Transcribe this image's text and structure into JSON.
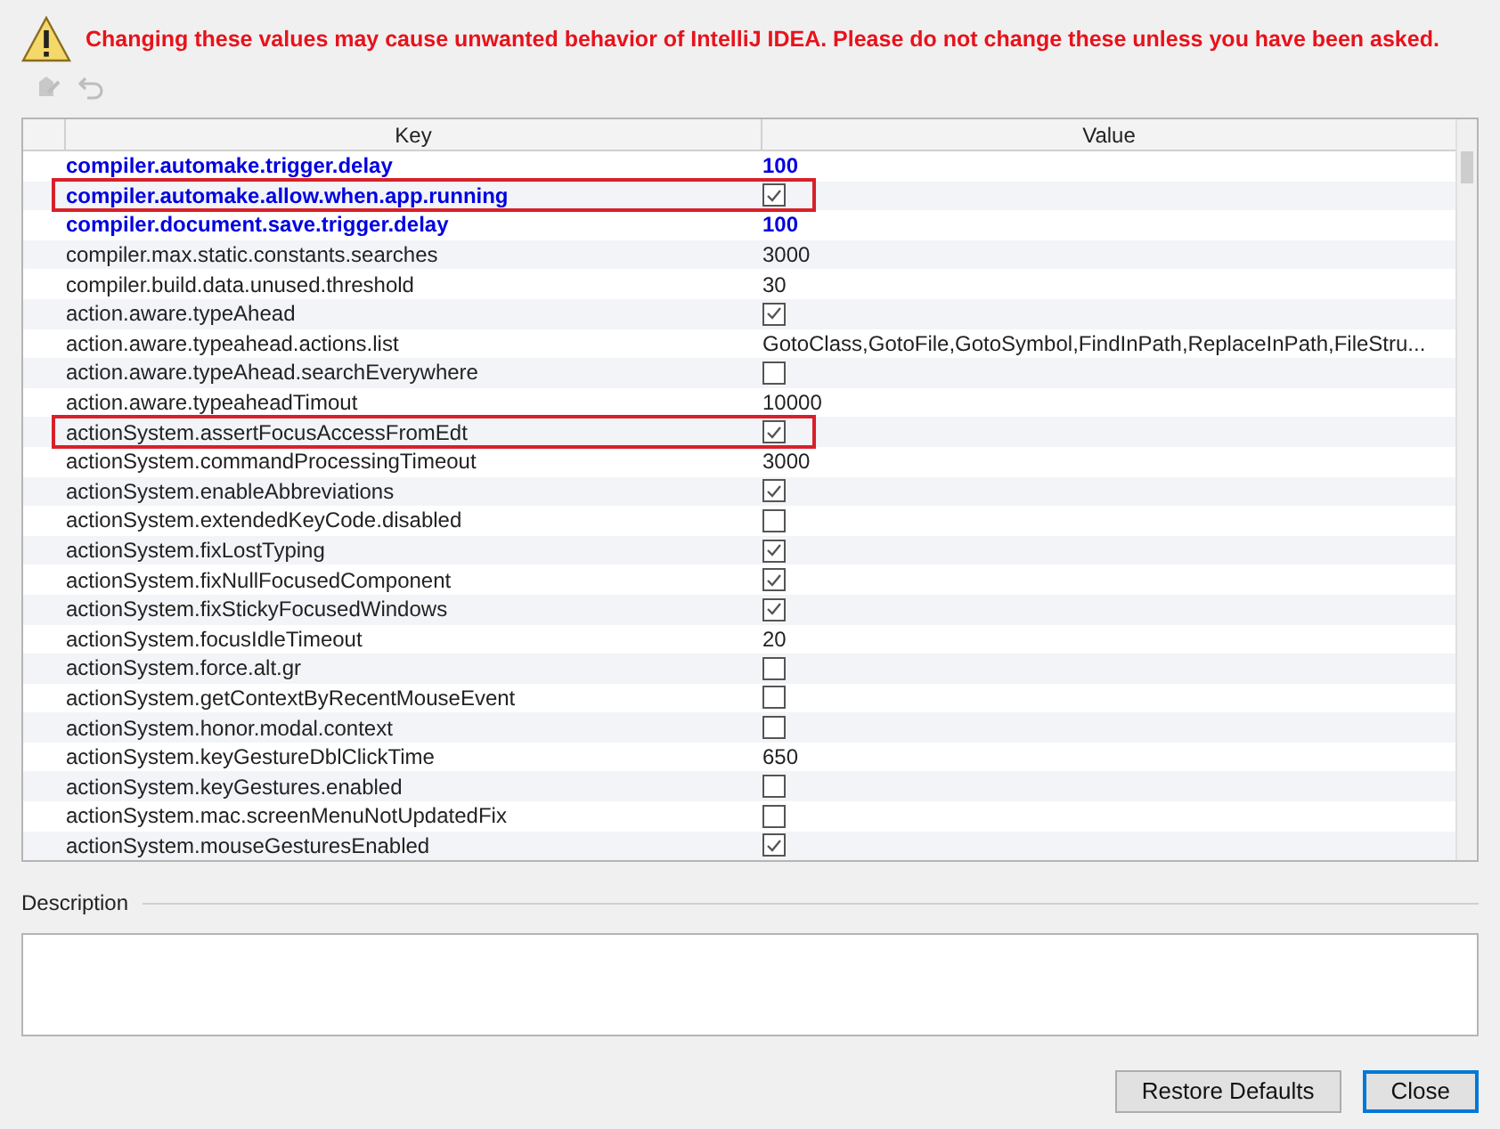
{
  "warning": {
    "text": "Changing these values may cause unwanted behavior of IntelliJ IDEA. Please do not change these unless you have been asked."
  },
  "table": {
    "columns": [
      "Key",
      "Value"
    ],
    "rows": [
      {
        "key": "compiler.automake.trigger.delay",
        "kind": "text",
        "value": "100",
        "modified": true,
        "highlighted": false
      },
      {
        "key": "compiler.automake.allow.when.app.running",
        "kind": "checkbox",
        "checked": true,
        "modified": true,
        "highlighted": true
      },
      {
        "key": "compiler.document.save.trigger.delay",
        "kind": "text",
        "value": "100",
        "modified": true,
        "highlighted": false
      },
      {
        "key": "compiler.max.static.constants.searches",
        "kind": "text",
        "value": "3000",
        "modified": false,
        "highlighted": false
      },
      {
        "key": "compiler.build.data.unused.threshold",
        "kind": "text",
        "value": "30",
        "modified": false,
        "highlighted": false
      },
      {
        "key": "action.aware.typeAhead",
        "kind": "checkbox",
        "checked": true,
        "modified": false,
        "highlighted": false
      },
      {
        "key": "action.aware.typeahead.actions.list",
        "kind": "text",
        "value": "GotoClass,GotoFile,GotoSymbol,FindInPath,ReplaceInPath,FileStru...",
        "modified": false,
        "highlighted": false
      },
      {
        "key": "action.aware.typeAhead.searchEverywhere",
        "kind": "checkbox",
        "checked": false,
        "modified": false,
        "highlighted": false
      },
      {
        "key": "action.aware.typeaheadTimout",
        "kind": "text",
        "value": "10000",
        "modified": false,
        "highlighted": false
      },
      {
        "key": "actionSystem.assertFocusAccessFromEdt",
        "kind": "checkbox",
        "checked": true,
        "modified": false,
        "highlighted": true
      },
      {
        "key": "actionSystem.commandProcessingTimeout",
        "kind": "text",
        "value": "3000",
        "modified": false,
        "highlighted": false
      },
      {
        "key": "actionSystem.enableAbbreviations",
        "kind": "checkbox",
        "checked": true,
        "modified": false,
        "highlighted": false
      },
      {
        "key": "actionSystem.extendedKeyCode.disabled",
        "kind": "checkbox",
        "checked": false,
        "modified": false,
        "highlighted": false
      },
      {
        "key": "actionSystem.fixLostTyping",
        "kind": "checkbox",
        "checked": true,
        "modified": false,
        "highlighted": false
      },
      {
        "key": "actionSystem.fixNullFocusedComponent",
        "kind": "checkbox",
        "checked": true,
        "modified": false,
        "highlighted": false
      },
      {
        "key": "actionSystem.fixStickyFocusedWindows",
        "kind": "checkbox",
        "checked": true,
        "modified": false,
        "highlighted": false
      },
      {
        "key": "actionSystem.focusIdleTimeout",
        "kind": "text",
        "value": "20",
        "modified": false,
        "highlighted": false
      },
      {
        "key": "actionSystem.force.alt.gr",
        "kind": "checkbox",
        "checked": false,
        "modified": false,
        "highlighted": false
      },
      {
        "key": "actionSystem.getContextByRecentMouseEvent",
        "kind": "checkbox",
        "checked": false,
        "modified": false,
        "highlighted": false
      },
      {
        "key": "actionSystem.honor.modal.context",
        "kind": "checkbox",
        "checked": false,
        "modified": false,
        "highlighted": false
      },
      {
        "key": "actionSystem.keyGestureDblClickTime",
        "kind": "text",
        "value": "650",
        "modified": false,
        "highlighted": false
      },
      {
        "key": "actionSystem.keyGestures.enabled",
        "kind": "checkbox",
        "checked": false,
        "modified": false,
        "highlighted": false
      },
      {
        "key": "actionSystem.mac.screenMenuNotUpdatedFix",
        "kind": "checkbox",
        "checked": false,
        "modified": false,
        "highlighted": false
      },
      {
        "key": "actionSystem.mouseGesturesEnabled",
        "kind": "checkbox",
        "checked": true,
        "modified": false,
        "highlighted": false
      }
    ]
  },
  "description": {
    "label": "Description"
  },
  "buttons": [
    {
      "label": "Restore Defaults",
      "focused": false
    },
    {
      "label": "Close",
      "focused": true
    }
  ]
}
